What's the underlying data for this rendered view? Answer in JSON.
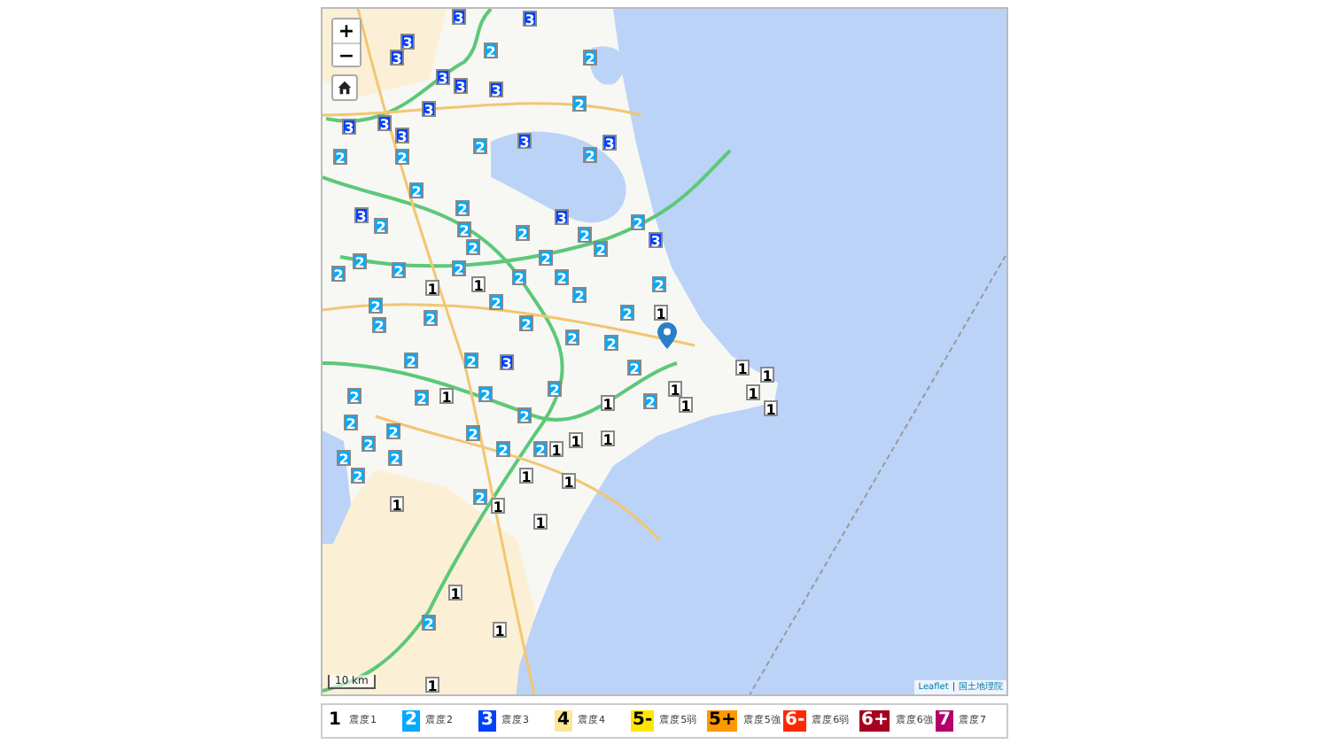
{
  "map": {
    "zoom_in": "+",
    "zoom_out": "−",
    "scale": "10 km",
    "attribution": [
      {
        "kind": "link",
        "label": "Leaflet"
      },
      {
        "kind": "separator",
        "label": "|"
      },
      {
        "kind": "link",
        "label": "国土地理院"
      }
    ],
    "markers": [
      {
        "label": "3",
        "color": "#0041ff"
      },
      {
        "label": "3",
        "color": "#0041ff"
      },
      {
        "label": "3",
        "color": "#0041ff"
      },
      {
        "label": "3",
        "color": "#0041ff"
      },
      {
        "label": "2",
        "color": "#00aaff"
      },
      {
        "label": "2",
        "color": "#00aaff"
      },
      {
        "label": "3",
        "color": "#0041ff"
      },
      {
        "label": "3",
        "color": "#0041ff"
      },
      {
        "label": "3",
        "color": "#0041ff"
      },
      {
        "label": "3",
        "color": "#0041ff"
      },
      {
        "label": "2",
        "color": "#00aaff"
      },
      {
        "label": "3",
        "color": "#0041ff"
      },
      {
        "label": "3",
        "color": "#0041ff"
      },
      {
        "label": "3",
        "color": "#0041ff"
      },
      {
        "label": "2",
        "color": "#00aaff"
      },
      {
        "label": "3",
        "color": "#0041ff"
      },
      {
        "label": "3",
        "color": "#0041ff"
      },
      {
        "label": "2",
        "color": "#00aaff"
      },
      {
        "label": "2",
        "color": "#00aaff"
      },
      {
        "label": "2",
        "color": "#00aaff"
      },
      {
        "label": "2",
        "color": "#00aaff"
      },
      {
        "label": "3",
        "color": "#0041ff"
      },
      {
        "label": "2",
        "color": "#00aaff"
      },
      {
        "label": "3",
        "color": "#0041ff"
      },
      {
        "label": "2",
        "color": "#00aaff"
      },
      {
        "label": "2",
        "color": "#00aaff"
      },
      {
        "label": "2",
        "color": "#00aaff"
      },
      {
        "label": "2",
        "color": "#00aaff"
      },
      {
        "label": "2",
        "color": "#00aaff"
      },
      {
        "label": "3",
        "color": "#0041ff"
      },
      {
        "label": "2",
        "color": "#00aaff"
      },
      {
        "label": "2",
        "color": "#00aaff"
      },
      {
        "label": "2",
        "color": "#00aaff"
      },
      {
        "label": "2",
        "color": "#00aaff"
      },
      {
        "label": "2",
        "color": "#00aaff"
      },
      {
        "label": "2",
        "color": "#00aaff"
      },
      {
        "label": "2",
        "color": "#00aaff"
      },
      {
        "label": "2",
        "color": "#00aaff"
      },
      {
        "label": "2",
        "color": "#00aaff"
      },
      {
        "label": "1",
        "color": "#ffffff"
      },
      {
        "label": "1",
        "color": "#ffffff"
      },
      {
        "label": "2",
        "color": "#00aaff"
      },
      {
        "label": "2",
        "color": "#00aaff"
      },
      {
        "label": "2",
        "color": "#00aaff"
      },
      {
        "label": "2",
        "color": "#00aaff"
      },
      {
        "label": "2",
        "color": "#00aaff"
      },
      {
        "label": "1",
        "color": "#ffffff"
      },
      {
        "label": "2",
        "color": "#00aaff"
      },
      {
        "label": "2",
        "color": "#00aaff"
      },
      {
        "label": "2",
        "color": "#00aaff"
      },
      {
        "label": "2",
        "color": "#00aaff"
      },
      {
        "label": "2",
        "color": "#00aaff"
      },
      {
        "label": "2",
        "color": "#00aaff"
      },
      {
        "label": "2",
        "color": "#00aaff"
      },
      {
        "label": "3",
        "color": "#0041ff"
      },
      {
        "label": "2",
        "color": "#00aaff"
      },
      {
        "label": "1",
        "color": "#ffffff"
      },
      {
        "label": "1",
        "color": "#ffffff"
      },
      {
        "label": "2",
        "color": "#00aaff"
      },
      {
        "label": "2",
        "color": "#00aaff"
      },
      {
        "label": "1",
        "color": "#ffffff"
      },
      {
        "label": "2",
        "color": "#00aaff"
      },
      {
        "label": "2",
        "color": "#00aaff"
      },
      {
        "label": "1",
        "color": "#ffffff"
      },
      {
        "label": "2",
        "color": "#00aaff"
      },
      {
        "label": "1",
        "color": "#ffffff"
      },
      {
        "label": "1",
        "color": "#ffffff"
      },
      {
        "label": "1",
        "color": "#ffffff"
      },
      {
        "label": "1",
        "color": "#ffffff"
      },
      {
        "label": "2",
        "color": "#00aaff"
      },
      {
        "label": "2",
        "color": "#00aaff"
      },
      {
        "label": "2",
        "color": "#00aaff"
      },
      {
        "label": "2",
        "color": "#00aaff"
      },
      {
        "label": "2",
        "color": "#00aaff"
      },
      {
        "label": "2",
        "color": "#00aaff"
      },
      {
        "label": "2",
        "color": "#00aaff"
      },
      {
        "label": "1",
        "color": "#ffffff"
      },
      {
        "label": "1",
        "color": "#ffffff"
      },
      {
        "label": "1",
        "color": "#ffffff"
      },
      {
        "label": "2",
        "color": "#00aaff"
      },
      {
        "label": "2",
        "color": "#00aaff"
      },
      {
        "label": "2",
        "color": "#00aaff"
      },
      {
        "label": "1",
        "color": "#ffffff"
      },
      {
        "label": "1",
        "color": "#ffffff"
      },
      {
        "label": "1",
        "color": "#ffffff"
      },
      {
        "label": "2",
        "color": "#00aaff"
      },
      {
        "label": "1",
        "color": "#ffffff"
      },
      {
        "label": "1",
        "color": "#ffffff"
      },
      {
        "label": "1",
        "color": "#ffffff"
      },
      {
        "label": "2",
        "color": "#00aaff"
      },
      {
        "label": "1",
        "color": "#ffffff"
      },
      {
        "label": "1",
        "color": "#ffffff"
      }
    ]
  },
  "legend": [
    {
      "badge": "1",
      "label": "震度1",
      "color": "#ffffff"
    },
    {
      "badge": "2",
      "label": "震度2",
      "color": "#00aaff"
    },
    {
      "badge": "3",
      "label": "震度3",
      "color": "#0041ff"
    },
    {
      "badge": "4",
      "label": "震度4",
      "color": "#fae696"
    },
    {
      "badge": "5-",
      "label": "震度5弱",
      "color": "#ffe600"
    },
    {
      "badge": "5+",
      "label": "震度5強",
      "color": "#ff9900"
    },
    {
      "badge": "6-",
      "label": "震度6弱",
      "color": "#ff2800"
    },
    {
      "badge": "6+",
      "label": "震度6強",
      "color": "#a50021"
    },
    {
      "badge": "7",
      "label": "震度7",
      "color": "#b40068"
    }
  ]
}
